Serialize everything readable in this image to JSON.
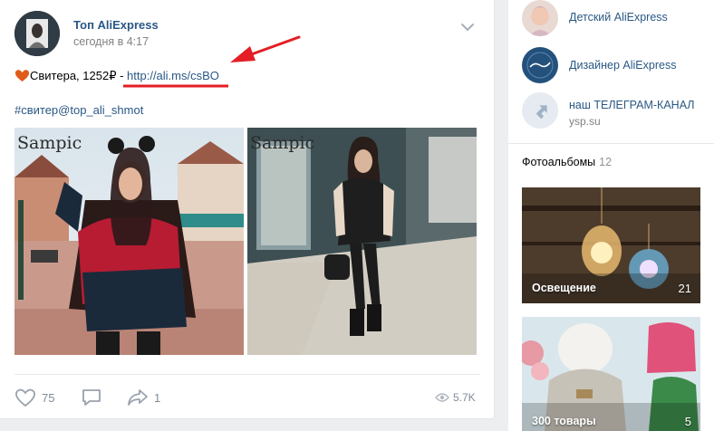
{
  "post": {
    "author": "Топ AliExpress",
    "time": "сегодня в 4:17",
    "text_prefix": "Свитера, 1252₽ - ",
    "link": "http://ali.ms/csBO",
    "hashtag": "#свитер@top_ali_shmot",
    "watermark": "Sampic",
    "likes": "75",
    "shares": "1",
    "views": "5.7K"
  },
  "sidebar": {
    "links": [
      {
        "title": "Детский AliExpress",
        "subtitle": ""
      },
      {
        "title": "Дизайнер AliExpress",
        "subtitle": ""
      },
      {
        "title": "наш ТЕЛЕГРАМ-КАНАЛ",
        "subtitle": "ysp.su"
      }
    ],
    "albums_label": "Фотоальбомы",
    "albums_count": "12",
    "albums": [
      {
        "title": "Освещение",
        "count": "21"
      },
      {
        "title": "300 товары",
        "count": "5"
      }
    ]
  },
  "colors": {
    "link_blue": "#2a5885",
    "annotation_red": "#e31e24",
    "page_bg": "#edeef0"
  }
}
